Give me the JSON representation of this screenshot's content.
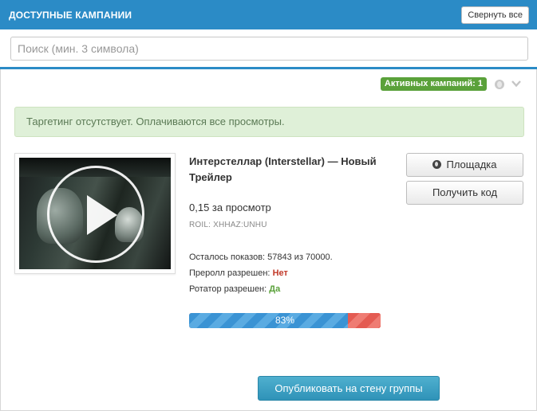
{
  "header": {
    "title": "ДОСТУПНЫЕ КАМПАНИИ",
    "collapse_label": "Свернуть все"
  },
  "search": {
    "placeholder": "Поиск (мин. 3 символа)",
    "value": ""
  },
  "toolbar": {
    "active_badge": "Активных кампаний: 1",
    "icons": [
      "globe-icon",
      "chevron-down-icon"
    ]
  },
  "alert": {
    "text": "Таргетинг отсутствует. Оплачиваются все просмотры."
  },
  "campaign": {
    "title": "Интерстеллар (Interstellar) — Новый Трейлер",
    "price": "0,15 за просмотр",
    "roil": "ROIL: XHHAZ:UNHU",
    "remaining_label": "Осталось показов: 57843 из 70000.",
    "preroll_label": "Преролл разрешен:",
    "preroll_value": "Нет",
    "rotator_label": "Ротатор разрешен:",
    "rotator_value": "Да",
    "progress_percent": 83,
    "progress_label": "83%",
    "thumbnail_icon": "play-icon"
  },
  "actions": {
    "platform_label": "Площадка",
    "get_code_label": "Получить код",
    "publish_label": "Опубликовать на стену группы"
  },
  "colors": {
    "header": "#2b8bc6",
    "badge": "#5aa13a",
    "alert_bg": "#dff0d8",
    "progress_fill": "#3a93d4",
    "progress_rest": "#e45b52",
    "publish_button": "#3aa0c3",
    "no": "#c23a2a",
    "yes": "#5aa13a"
  }
}
